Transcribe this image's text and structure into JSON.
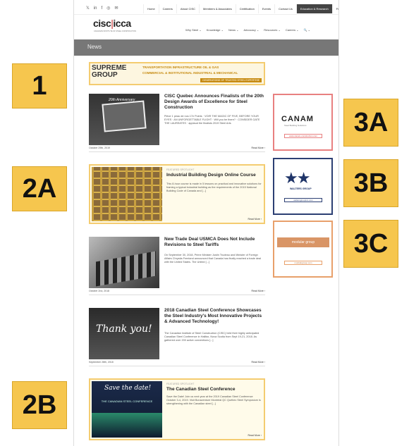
{
  "topbar": {
    "social": [
      "𝕏",
      "in",
      "f",
      "◎",
      "✉"
    ],
    "links": [
      "Home",
      "Careers",
      "About CISC",
      "Members & Associates",
      "Certification",
      "Events",
      "Contact Us",
      "Education & Research",
      "Français"
    ]
  },
  "header": {
    "logo_left": "cisc",
    "logo_right": "icca",
    "logo_sub": "CANADIAN INSTITUTE OF STEEL CONSTRUCTION",
    "nav": [
      "Why Steel ⌄",
      "Knowledge ⌄",
      "News ⌄",
      "Advocacy ⌄",
      "Resources ⌄",
      "Careers ⌄",
      "🔍 ⌄"
    ]
  },
  "newsbar": {
    "title": "News"
  },
  "banner": {
    "name_line1": "SUPREME",
    "name_line2": "GROUP",
    "line1": "TRANSPORTATION INFRASTRUCTURE  OIL & GAS",
    "line2": "COMMERCIAL & INSTITUTIONAL  INDUSTRIAL & MECHANICAL",
    "tagline": "GENERATIONS OF TRUSTED STEEL EXPERTISE"
  },
  "articles": [
    {
      "title": "CISC Quebec Announces Finalists of the 20th Design Awards of Excellence for Steel Construction",
      "body": "Pièce 1 peau de nos 17e Points · VOIR THE MAGIC OF FIVE, BEFORE YOUR EYES · AN UNFORGETTABLE FLIGHT · Will you be there? · CONSIDER GATE THE LAUREATES · applaud the finalists 2019 Steel Arts",
      "date": "October 29th, 2019",
      "read_more": "Read More ›",
      "thumb_text": "20th Anniversary"
    },
    {
      "tag": "FEATURED SPOTLIGHT",
      "title": "Industrial Building Design Online Course",
      "body": "This 8-hour course is made in 5 lessons on practical and innovative solutions for framing a typical industrial building as the requirements of the 2015 National Building Code of Canada and [...]",
      "read_more": "Read More ›"
    },
    {
      "title": "New Trade Deal USMCA Does Not Include Revisions to Steel Tariffs",
      "body": "On September 30, 2018, Prime Minister Justin Trudeau and Minister of Foreign Affairs Chrystia Freeland announced that Canada has finally reached a trade deal with the United States. The United [...]",
      "date": "October 2nd, 2018",
      "read_more": "Read More ›"
    },
    {
      "title": "2018 Canadian Steel Conference Showcases the Steel Industry's Most Innovative Projects & Advanced Technology!",
      "body": "The Canadian Institute of Steel Construction (CISC) held their highly anticipated Canadian Steel Conference in Halifax, Nova Scotia from Sept 19-21, 2018. As gathered over 200 active conventions [...]",
      "date": "September 28th, 2018",
      "read_more": "Read More ›",
      "thumb_text": "Thank you!"
    },
    {
      "tag": "FEATURED SPOTLIGHT",
      "title": "The Canadian Steel Conference",
      "body": "Save the Date! Join us next year at the 2019 Canadian Steel Conference October 3-4, 2019. Visit Bonaventure Montréal QC Québec Steel Symposium is strengthening with the Canadian steel [...]",
      "read_more": "Read More ›",
      "thumb_text": "Save the date!",
      "thumb_sub": "THE CANADIAN STEEL CONFERENCE"
    }
  ],
  "ads": [
    {
      "brand": "CANAM",
      "sub": "Steel Building Solutions",
      "button": "www.canam-construction.com"
    },
    {
      "brand": "★★",
      "sub": "WALTERS GROUP",
      "button": "waltersgroupinc.com"
    },
    {
      "brand": "modular group",
      "sub": "",
      "button": "modulargroup.com"
    }
  ],
  "callouts": [
    "1",
    "2A",
    "3A",
    "3B",
    "2B",
    "3C"
  ],
  "colors": {
    "callout": "#f6c64e",
    "highlight_border": "#f4cc70",
    "ad1_border": "#e88080",
    "ad2_border": "#2c3f73",
    "ad3_border": "#e8a06b"
  }
}
